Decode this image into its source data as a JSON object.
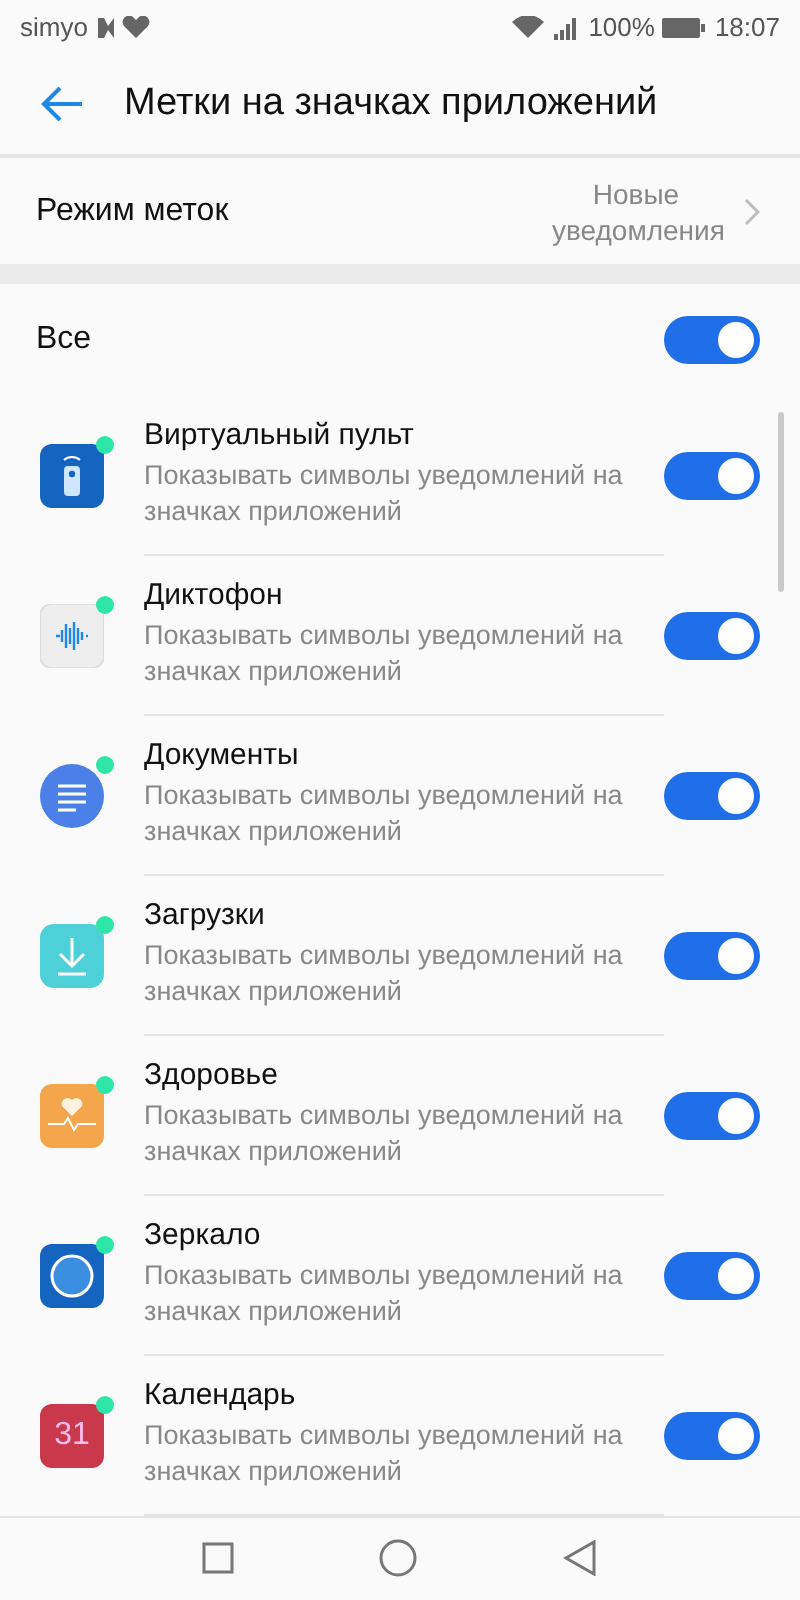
{
  "status_bar": {
    "carrier": "simyo",
    "battery": "100%",
    "time": "18:07"
  },
  "header": {
    "title": "Метки на значках приложений"
  },
  "mode_row": {
    "label": "Режим меток",
    "value": "Новые уведомления"
  },
  "all_row": {
    "label": "Все",
    "on": true
  },
  "apps": [
    {
      "name": "Виртуальный пульт",
      "description": "Показывать символы уведомлений на значках приложений",
      "kind": "remote",
      "badge": true,
      "on": true
    },
    {
      "name": "Диктофон",
      "description": "Показывать символы уведомлений на значках приложений",
      "kind": "recorder",
      "badge": true,
      "on": true
    },
    {
      "name": "Документы",
      "description": "Показывать символы уведомлений на значках приложений",
      "kind": "documents",
      "badge": true,
      "on": true
    },
    {
      "name": "Загрузки",
      "description": "Показывать символы уведомлений на значках приложений",
      "kind": "downloads",
      "badge": true,
      "on": true
    },
    {
      "name": "Здоровье",
      "description": "Показывать символы уведомлений на значках приложений",
      "kind": "health",
      "badge": true,
      "on": true
    },
    {
      "name": "Зеркало",
      "description": "Показывать символы уведомлений на значках приложений",
      "kind": "mirror",
      "badge": true,
      "on": true
    },
    {
      "name": "Календарь",
      "description": "Показывать символы уведомлений на значках приложений",
      "kind": "calendar",
      "icon_text": "31",
      "badge": true,
      "on": true
    }
  ]
}
